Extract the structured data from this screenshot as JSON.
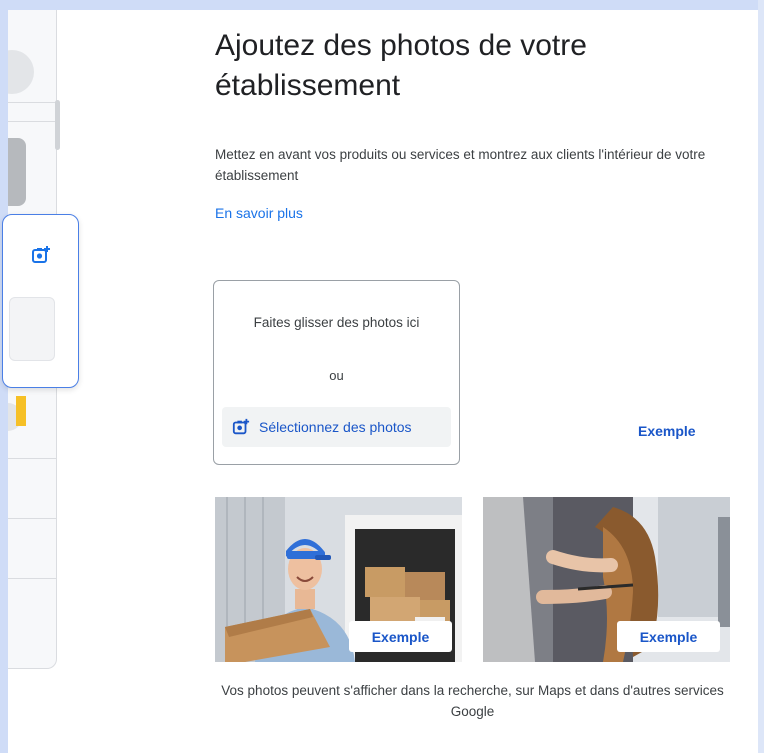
{
  "header": {
    "title": "Ajoutez des photos de votre établissement"
  },
  "intro": {
    "description": "Mettez en avant vos produits ou services et montrez aux clients l'intérieur de votre établissement",
    "learn_more": "En savoir plus"
  },
  "upload": {
    "drag_text": "Faites glisser des photos ici",
    "or_text": "ou",
    "select_label": "Sélectionnez des photos",
    "select_icon": "add-photo-icon"
  },
  "examples": {
    "top_label": "Exemple",
    "photo_1": {
      "label": "Exemple",
      "subject": "delivery-worker-holding-box"
    },
    "photo_2": {
      "label": "Exemple",
      "subject": "hair-styling"
    }
  },
  "footer": {
    "note": "Vos photos peuvent s'afficher dans la recherche, sur Maps et dans d'autres services Google"
  },
  "colors": {
    "accent": "#1a73e8",
    "link_dark": "#1a56c8",
    "frame": "#cfdcf7"
  }
}
